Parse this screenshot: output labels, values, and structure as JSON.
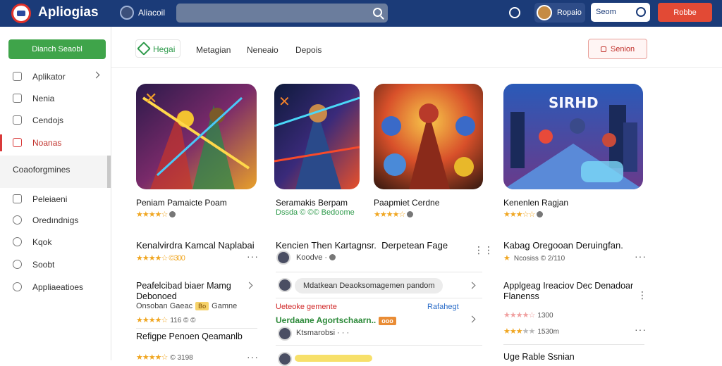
{
  "header": {
    "app_title": "Apliogias",
    "user_name": "Aliacoil",
    "search_placeholder": "",
    "profile_name": "Ropaio",
    "toggle_label": "Seom",
    "login_label": "Robbe"
  },
  "sidebar": {
    "primary_button": "Dianch Seaobl",
    "items": [
      {
        "label": "Aplikator"
      },
      {
        "label": "Nenia"
      },
      {
        "label": "Cendojs"
      },
      {
        "label": "Noanas"
      }
    ],
    "section_label": "Coaoforgmines",
    "sub_items": [
      {
        "label": "Peleiaeni"
      },
      {
        "label": "Oredındnigs"
      },
      {
        "label": "Kqok"
      },
      {
        "label": "Soobt"
      },
      {
        "label": "Appliaeatioes"
      }
    ]
  },
  "tabs": {
    "active": "Hegai",
    "items": [
      "Metagian",
      "Neneaio",
      "Depois"
    ],
    "right_button": "Senion"
  },
  "cards": [
    {
      "title": "Peniam Pamaicte Poam",
      "stars": "★★★★☆",
      "colors": [
        "#1a1a3a",
        "#e94a2a",
        "#f3c330"
      ],
      "icon": "game-art-heroes"
    },
    {
      "title": "Seramakis Berpam",
      "subtitle": "Dssda © ©© Bedoome",
      "stars": "",
      "colors": [
        "#101c3a",
        "#2a68d8",
        "#e84a2a"
      ],
      "icon": "game-art-warrior"
    },
    {
      "title": "Paapmiet Cerdne",
      "stars": "★★★★☆",
      "colors": [
        "#3a1a10",
        "#f08a20",
        "#b8321a"
      ],
      "icon": "game-art-battle"
    },
    {
      "title": "Kenenlen Ragjan",
      "stars": "★★★☆☆",
      "colors": [
        "#1a3a6a",
        "#4aa8e8",
        "#d84a3a"
      ],
      "icon": "game-art-city"
    }
  ],
  "list_col1": [
    {
      "title": "Kenalvirdra Kamcal Naplabai",
      "meta": "★★★★☆ ©300"
    },
    {
      "title": "Peafelcibad biaer Mamg",
      "title2": "Debonoed",
      "sub": "Onsoban Gaeac",
      "badge": "Bo",
      "sub2": "Gamne",
      "stars": "★★★★☆",
      "meta": "116 © ©"
    },
    {
      "title": "Refigpe Penoen Qeamanlb",
      "stars": "★★★★☆",
      "meta": "© 3198"
    }
  ],
  "list_col2": [
    {
      "title": "Kencien Then Kartagnsr.",
      "title_b": "Derpetean Fage",
      "meta": "Koodve ·"
    },
    {
      "pill": "Mdatkean Deaoksomagemen pandom"
    },
    {
      "red": "Ueteoke gemente",
      "blue": "Rafahegt"
    },
    {
      "green": "Uerdaane Agortschaarn..",
      "badge": "ooo",
      "meta": "Ktsmarobsi · · ·"
    }
  ],
  "list_col3": [
    {
      "title": "Kabag Oregooan Deruingfan.",
      "meta": "Ncosiss © 2/110"
    },
    {
      "title": "Applgeag Ireaciov Dec Denadoar",
      "title2": "Flanenss",
      "stars": "★★★★☆",
      "meta": "1300"
    },
    {
      "meta2": "1530m"
    },
    {
      "title": "Uge Rable Ssnian"
    }
  ],
  "colors": {
    "topbar": "#1b3b78",
    "accent_red": "#e24a35",
    "accent_green": "#3fa44a",
    "star": "#f0a621"
  }
}
